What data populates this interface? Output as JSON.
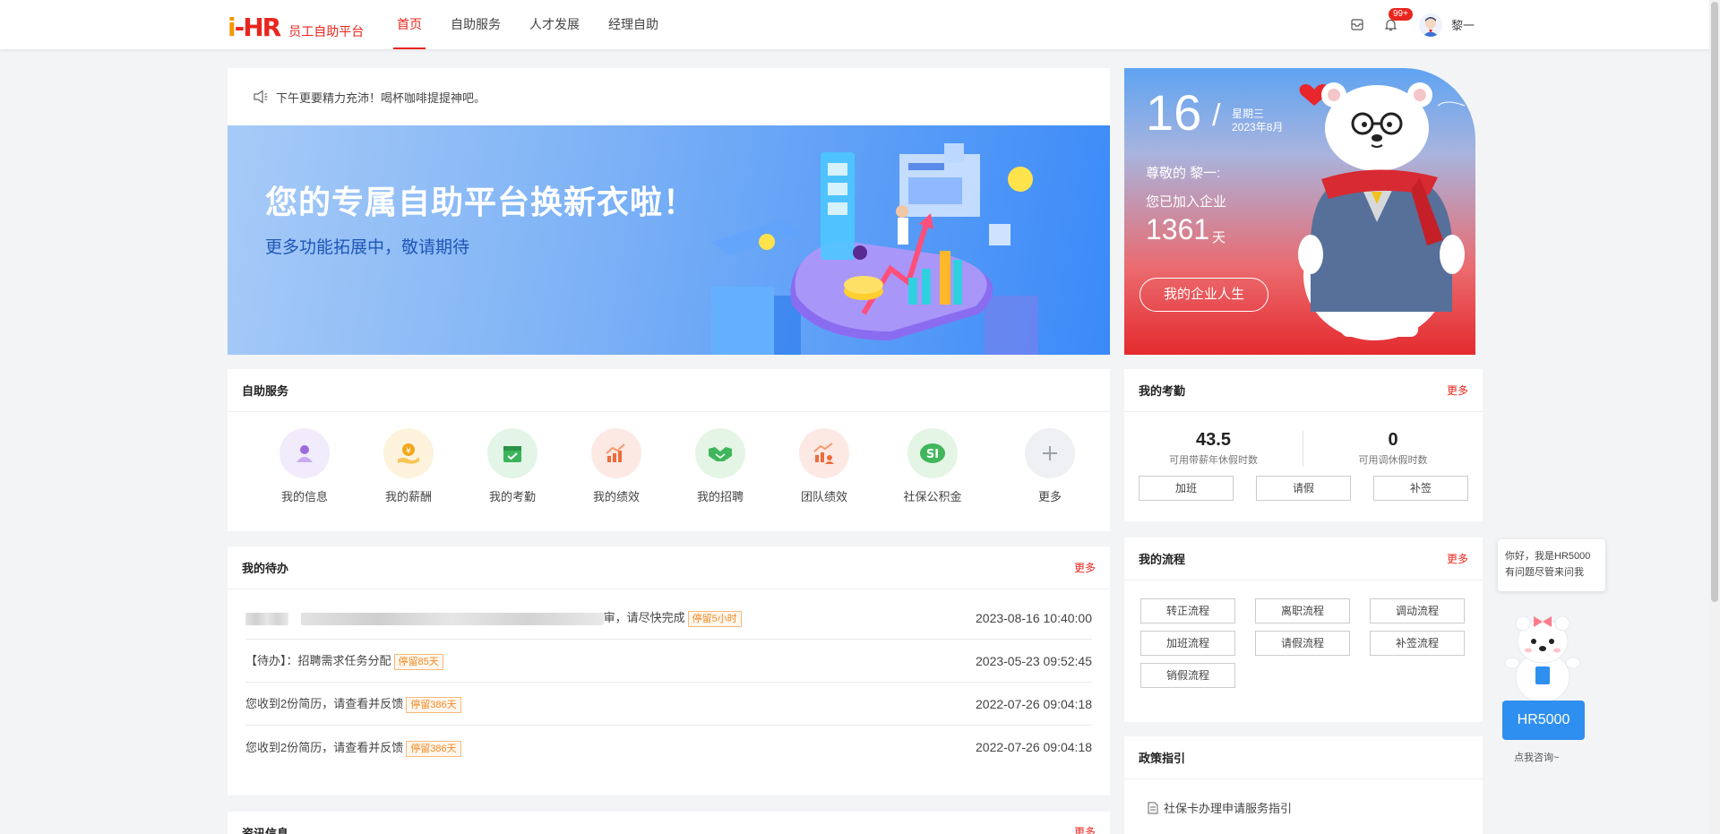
{
  "header": {
    "logo_text": "员工自助平台",
    "nav": [
      "首页",
      "自助服务",
      "人才发展",
      "经理自助"
    ],
    "badge": "99+",
    "username": "黎一"
  },
  "notice": {
    "text": "下午更要精力充沛！喝杯咖啡提提神吧。"
  },
  "banner": {
    "title": "您的专属自助平台换新衣啦！",
    "subtitle": "更多功能拓展中，敬请期待"
  },
  "welcome": {
    "day": "16",
    "weekday": "星期三",
    "month": "2023年8月",
    "greeting": "尊敬的 黎一:",
    "joined": "您已加入企业",
    "days": "1361",
    "days_unit": "天",
    "button": "我的企业人生"
  },
  "services": {
    "title": "自助服务",
    "items": [
      {
        "label": "我的信息",
        "icon": "user-icon",
        "bg": "#f1ebfb",
        "fg": "#9b6bdc"
      },
      {
        "label": "我的薪酬",
        "icon": "salary-icon",
        "bg": "#fdf3dd",
        "fg": "#f2a81d"
      },
      {
        "label": "我的考勤",
        "icon": "calendar-icon",
        "bg": "#e3f5e6",
        "fg": "#3bb45a"
      },
      {
        "label": "我的绩效",
        "icon": "performance-icon",
        "bg": "#fde9e3",
        "fg": "#ef6b3c"
      },
      {
        "label": "我的招聘",
        "icon": "handshake-icon",
        "bg": "#e4f5e5",
        "fg": "#41b65c"
      },
      {
        "label": "团队绩效",
        "icon": "team-performance-icon",
        "bg": "#fde9e3",
        "fg": "#ef6b3c"
      },
      {
        "label": "社保公积金",
        "icon": "social-security-icon",
        "bg": "#e4f5e5",
        "fg": "#41b65c"
      },
      {
        "label": "更多",
        "icon": "plus-icon",
        "bg": "#eff0f3",
        "fg": "#9aa0aa"
      }
    ]
  },
  "todo": {
    "title": "我的待办",
    "more": "更多",
    "rows": [
      {
        "text": "审，请尽快完成",
        "tag": "停留5小时",
        "time": "2023-08-16 10:40:00"
      },
      {
        "text": "【待办】：招聘需求任务分配",
        "tag": "停留85天",
        "time": "2023-05-23 09:52:45"
      },
      {
        "text": "您收到2份简历，请查看并反馈",
        "tag": "停留386天",
        "time": "2022-07-26 09:04:18"
      },
      {
        "text": "您收到2份简历，请查看并反馈",
        "tag": "停留386天",
        "time": "2022-07-26 09:04:18"
      }
    ]
  },
  "news": {
    "title": "资讯信息",
    "more": "更多"
  },
  "attendance": {
    "title": "我的考勤",
    "more": "更多",
    "annual": "43.5",
    "annual_label": "可用带薪年休假时数",
    "comp": "0",
    "comp_label": "可用调休假时数",
    "buttons": [
      "加班",
      "请假",
      "补签"
    ]
  },
  "flow": {
    "title": "我的流程",
    "more": "更多",
    "buttons": [
      "转正流程",
      "离职流程",
      "调动流程",
      "加班流程",
      "请假流程",
      "补签流程",
      "销假流程"
    ]
  },
  "policy": {
    "title": "政策指引",
    "items": [
      "社保卡办理申请服务指引"
    ]
  },
  "assistant": {
    "bubble": "你好，我是HR5000有问题尽管来问我",
    "button": "HR5000",
    "consult": "点我咨询~"
  }
}
